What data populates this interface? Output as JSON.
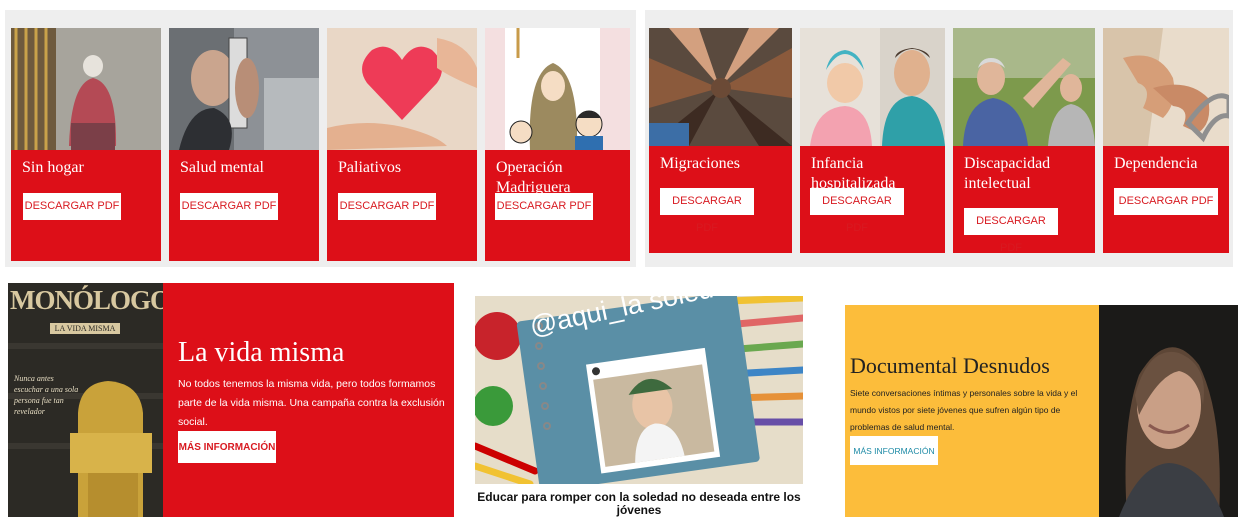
{
  "cards": [
    {
      "title": "Sin hogar",
      "button": "DESCARGAR PDF"
    },
    {
      "title": "Salud mental",
      "button": "DESCARGAR PDF"
    },
    {
      "title": "Paliativos",
      "button": "DESCARGAR PDF"
    },
    {
      "title": "Operación Madriguera",
      "button": "DESCARGAR PDF"
    },
    {
      "title": "Migraciones",
      "button": "DESCARGAR PDF"
    },
    {
      "title": "Infancia hospitalizada",
      "button": "DESCARGAR PDF"
    },
    {
      "title": "Discapacidad intelectual",
      "button": "DESCARGAR PDF"
    },
    {
      "title": "Dependencia",
      "button": "DESCARGAR PDF"
    }
  ],
  "banners": {
    "vida": {
      "poster_title": "MONÓLOGOS",
      "poster_subtitle": "LA VIDA MISMA",
      "poster_quote": "Nunca antes escuchar a una sola persona fue tan revelador",
      "title": "La vida misma",
      "description": "No todos tenemos la misma vida, pero todos formamos parte de la vida misma. Una campaña contra la exclusión social.",
      "button": "MÁS INFORMACIÓN"
    },
    "educar": {
      "handle": "@aqui_la soledad",
      "caption": "Educar para romper con la soledad no deseada entre los jóvenes"
    },
    "desnudos": {
      "title": "Documental Desnudos",
      "description": "Siete conversaciones íntimas y personales sobre la vida y el mundo vistos por siete jóvenes que sufren algún tipo de problemas de salud mental.",
      "button": "MÁS INFORMACIÓN"
    }
  },
  "colors": {
    "brand_red": "#dd0f18",
    "yellow": "#fcbd3b",
    "panel_gray": "#eeeeee"
  }
}
